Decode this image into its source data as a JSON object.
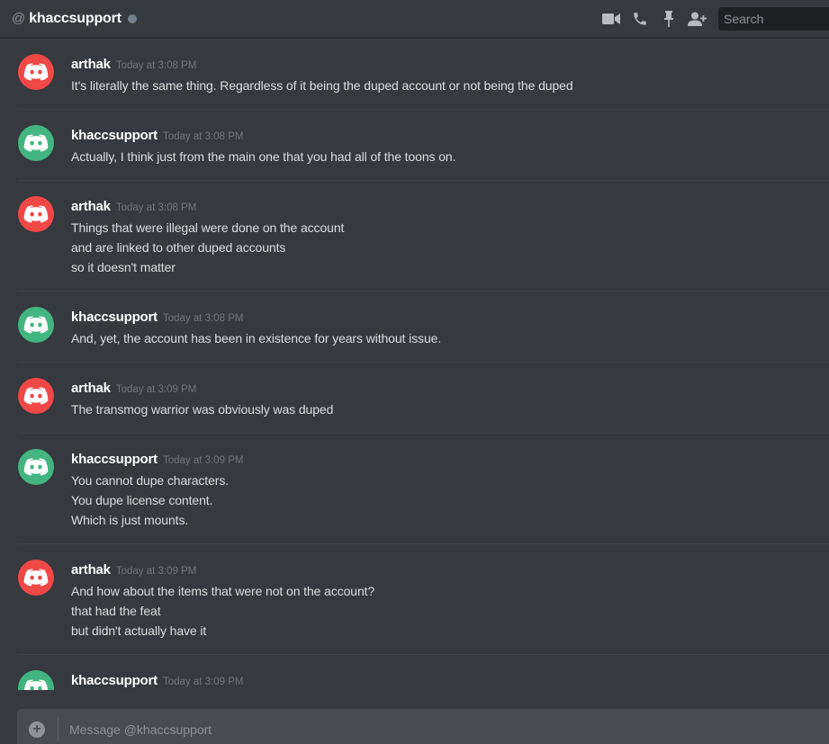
{
  "header": {
    "at_symbol": "@",
    "channel_name": "khaccsupport",
    "status_color": "#747f8d",
    "tools": [
      "video-call-icon",
      "voice-call-icon",
      "pin-icon",
      "add-friend-icon"
    ],
    "search_placeholder": "Search"
  },
  "colors": {
    "arthak_avatar": "#f04747",
    "khaccsupport_avatar": "#43b581",
    "background": "#36393e"
  },
  "messages": [
    {
      "user": "arthak",
      "avatar_color": "#f04747",
      "timestamp": "Today at 3:08 PM",
      "lines": [
        "It's literally the same thing. Regardless of it being the duped account or not being the duped"
      ]
    },
    {
      "user": "khaccsupport",
      "avatar_color": "#43b581",
      "timestamp": "Today at 3:08 PM",
      "lines": [
        "Actually, I think just from the main one that you had all of the toons on."
      ]
    },
    {
      "user": "arthak",
      "avatar_color": "#f04747",
      "timestamp": "Today at 3:08 PM",
      "lines": [
        "Things that were illegal were done on the account",
        "and are linked to other duped accounts",
        "so it doesn't matter"
      ]
    },
    {
      "user": "khaccsupport",
      "avatar_color": "#43b581",
      "timestamp": "Today at 3:08 PM",
      "lines": [
        "And, yet, the account has been in existence for years without issue."
      ]
    },
    {
      "user": "arthak",
      "avatar_color": "#f04747",
      "timestamp": "Today at 3:09 PM",
      "lines": [
        "The transmog warrior was obviously was duped"
      ]
    },
    {
      "user": "khaccsupport",
      "avatar_color": "#43b581",
      "timestamp": "Today at 3:09 PM",
      "lines": [
        "You cannot dupe characters.",
        "You dupe license content.",
        "Which is just mounts."
      ]
    },
    {
      "user": "arthak",
      "avatar_color": "#f04747",
      "timestamp": "Today at 3:09 PM",
      "lines": [
        "And how about the items that were not on the account?",
        "that had the feat",
        "but didn't actually have it"
      ]
    },
    {
      "user": "khaccsupport",
      "avatar_color": "#43b581",
      "timestamp": "Today at 3:09 PM",
      "lines": []
    }
  ],
  "composer": {
    "upload_symbol": "+",
    "placeholder": "Message @khaccsupport"
  }
}
